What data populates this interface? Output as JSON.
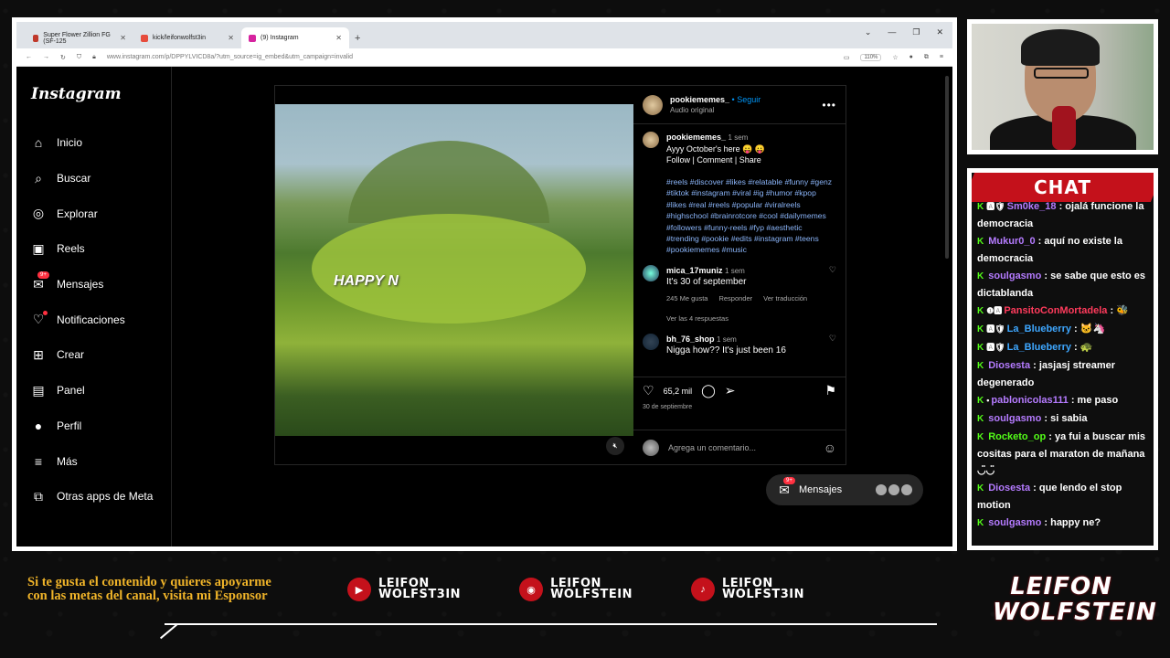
{
  "browser": {
    "tabs": [
      {
        "label": "Super Flower Zillion FG (SF-125",
        "color": "#c0392b"
      },
      {
        "label": "kick/leifonwolfst3in",
        "color": "#e74c3c"
      },
      {
        "label": "(9) Instagram",
        "color": "#d6249f"
      }
    ],
    "url": "www.instagram.com/p/DPPYLVICD8a/?utm_source=ig_embed&utm_campaign=invalid",
    "zoom": "110%"
  },
  "instagram": {
    "logo": "Instagram",
    "nav": [
      {
        "label": "Inicio",
        "icon": "home-icon",
        "glyph": "⌂"
      },
      {
        "label": "Buscar",
        "icon": "search-icon",
        "glyph": "⌕"
      },
      {
        "label": "Explorar",
        "icon": "compass-icon",
        "glyph": "◎"
      },
      {
        "label": "Reels",
        "icon": "reels-icon",
        "glyph": "▣"
      },
      {
        "label": "Mensajes",
        "icon": "messenger-icon",
        "glyph": "✉",
        "badge": "9+"
      },
      {
        "label": "Notificaciones",
        "icon": "heart-icon",
        "glyph": "♡",
        "dot": true
      },
      {
        "label": "Crear",
        "icon": "plus-icon",
        "glyph": "⊞"
      },
      {
        "label": "Panel",
        "icon": "dashboard-icon",
        "glyph": "▤"
      },
      {
        "label": "Perfil",
        "icon": "profile-icon",
        "glyph": "●"
      },
      {
        "label": "Más",
        "icon": "menu-icon",
        "glyph": "≡"
      },
      {
        "label": "Otras apps de Meta",
        "icon": "meta-apps-icon",
        "glyph": "⧉"
      }
    ],
    "post": {
      "video_caption": "HAPPY N",
      "author": "pookiememes_",
      "follow": "• Seguir",
      "audio": "Audio original",
      "caption": {
        "user": "pookiememes_",
        "time": "1 sem",
        "text": "Ayyy October's here 😛 😛",
        "links": "Follow | Comment | Share",
        "tags": "#reels #discover #likes #relatable #funny #genz #tiktok #instagram #viral #ig #humor #kpop #likes #real #reels #popular #viralreels #highschool #brainrotcore #cool #dailymemes #followers #funny-reels #fyp #aesthetic #trending #pookie #edits #instagram #teens #pookiememes #music"
      },
      "comments": [
        {
          "user": "mica_17muniz",
          "time": "1 sem",
          "text": "It's 30 of september",
          "likes": "245 Me gusta",
          "reply": "Responder",
          "translate": "Ver traducción",
          "replies": "Ver las 4 respuestas"
        },
        {
          "user": "bh_76_shop",
          "time": "1 sem",
          "text": "Nigga how?? It's just been 16"
        }
      ],
      "likes": "65,2 mil",
      "date": "30 de septiembre",
      "add_comment": "Agrega un comentario..."
    },
    "messages_pill": {
      "label": "Mensajes",
      "badge": "9+"
    }
  },
  "chat": {
    "title": "CHAT",
    "messages": [
      {
        "user": "Sm0ke_18",
        "color": "#b57bff",
        "badges": "🅰🛡",
        "text": ": ojalá funcione la democracia"
      },
      {
        "user": "Mukur0_0",
        "color": "#b57bff",
        "badges": "",
        "text": ": aquí no existe la democracia"
      },
      {
        "user": "soulgasmo",
        "color": "#b57bff",
        "badges": "",
        "text": ": se sabe que esto es dictablanda"
      },
      {
        "user": "PansitoConMortadela",
        "color": "#ff3b5c",
        "badges": "❶🅰",
        "text": ": 🐝"
      },
      {
        "user": "La_Blueberry",
        "color": "#3ea7ff",
        "badges": "🅰🛡",
        "text": ": 🐱🦄"
      },
      {
        "user": "La_Blueberry",
        "color": "#3ea7ff",
        "badges": "🅰🛡",
        "text": ": 🐢"
      },
      {
        "user": "Diosesta",
        "color": "#b57bff",
        "badges": "",
        "text": ": jasjasj streamer degenerado"
      },
      {
        "user": "pablonicolas111",
        "color": "#b57bff",
        "badges": "•",
        "text": ": me paso"
      },
      {
        "user": "soulgasmo",
        "color": "#b57bff",
        "badges": "",
        "text": ": si sabia"
      },
      {
        "user": "Rocketo_op",
        "color": "#53fc18",
        "badges": "",
        "text": ": ya fui a buscar mis cositas para el maraton de mañana ◡̈◡̈"
      },
      {
        "user": "Diosesta",
        "color": "#b57bff",
        "badges": "",
        "text": ": que lendo el stop motion"
      },
      {
        "user": "soulgasmo",
        "color": "#b57bff",
        "badges": "",
        "text": ": happy ne?"
      }
    ]
  },
  "footer": {
    "sponsor": "Si te gusta el contenido y quieres apoyarme con las metas del canal, visita mi Esponsor",
    "socials": [
      {
        "platform": "youtube",
        "icon": "youtube-icon",
        "glyph": "▶",
        "line1": "LEIFON",
        "line2": "WOLFST3IN"
      },
      {
        "platform": "instagram",
        "icon": "instagram-icon",
        "glyph": "◉",
        "line1": "LEIFON",
        "line2": "WOLFSTEIN"
      },
      {
        "platform": "tiktok",
        "icon": "tiktok-icon",
        "glyph": "♪",
        "line1": "LEIFON",
        "line2": "WOLFST3IN"
      }
    ],
    "brand_line1": "LEIFON",
    "brand_line2": "WOLFSTEIN"
  }
}
